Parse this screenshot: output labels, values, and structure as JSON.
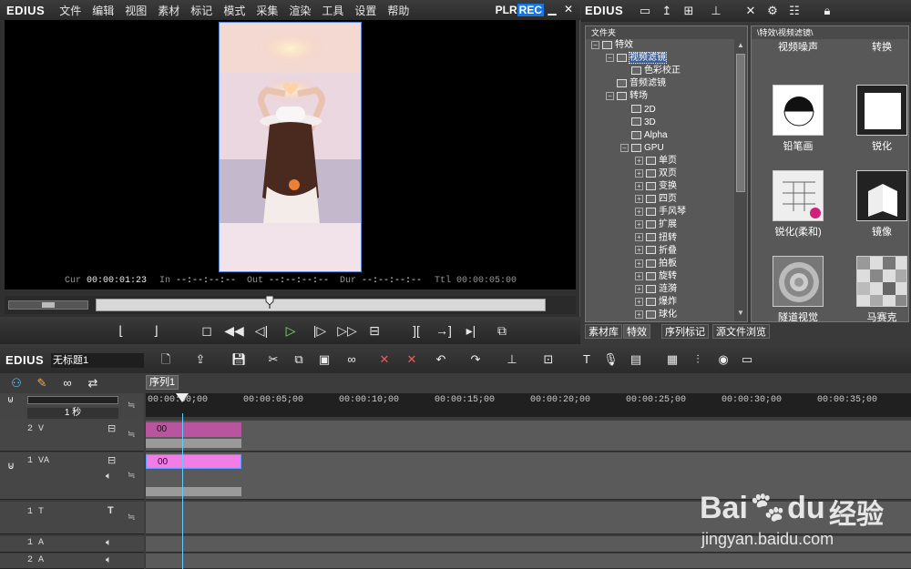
{
  "app": {
    "logo": "EDIUS",
    "plr": "PLR",
    "rec": "REC",
    "min_icon": "▁",
    "close_icon": "✕"
  },
  "menu": [
    "文件",
    "编辑",
    "视图",
    "素材",
    "标记",
    "模式",
    "采集",
    "渲染",
    "工具",
    "设置",
    "帮助"
  ],
  "player": {
    "cur_label": "Cur",
    "cur_value": "00:00:01:23",
    "in_label": "In",
    "in_value": "--:--:--:--",
    "out_label": "Out",
    "out_value": "--:--:--:--",
    "dur_label": "Dur",
    "dur_value": "--:--:--:--",
    "ttl_label": "Ttl",
    "ttl_value": "00:00:05:00"
  },
  "bin": {
    "logo": "EDIUS",
    "folder_header": "文件夹",
    "fx_header": "\\特效\\视频滤镜\\",
    "tree": [
      {
        "label": "特效",
        "indent": 0,
        "ex": "−",
        "sel": false
      },
      {
        "label": "视频滤镜",
        "indent": 1,
        "ex": "−",
        "sel": true
      },
      {
        "label": "色彩校正",
        "indent": 2,
        "ex": "",
        "sel": false
      },
      {
        "label": "音频滤镜",
        "indent": 1,
        "ex": "",
        "sel": false
      },
      {
        "label": "转场",
        "indent": 1,
        "ex": "−",
        "sel": false
      },
      {
        "label": "2D",
        "indent": 2,
        "ex": "",
        "sel": false
      },
      {
        "label": "3D",
        "indent": 2,
        "ex": "",
        "sel": false
      },
      {
        "label": "Alpha",
        "indent": 2,
        "ex": "",
        "sel": false
      },
      {
        "label": "GPU",
        "indent": 2,
        "ex": "−",
        "sel": false
      },
      {
        "label": "单页",
        "indent": 3,
        "ex": "+",
        "sel": false
      },
      {
        "label": "双页",
        "indent": 3,
        "ex": "+",
        "sel": false
      },
      {
        "label": "变换",
        "indent": 3,
        "ex": "+",
        "sel": false
      },
      {
        "label": "四页",
        "indent": 3,
        "ex": "+",
        "sel": false
      },
      {
        "label": "手风琴",
        "indent": 3,
        "ex": "+",
        "sel": false
      },
      {
        "label": "扩展",
        "indent": 3,
        "ex": "+",
        "sel": false
      },
      {
        "label": "扭转",
        "indent": 3,
        "ex": "+",
        "sel": false
      },
      {
        "label": "折叠",
        "indent": 3,
        "ex": "+",
        "sel": false
      },
      {
        "label": "拍板",
        "indent": 3,
        "ex": "+",
        "sel": false
      },
      {
        "label": "旋转",
        "indent": 3,
        "ex": "+",
        "sel": false
      },
      {
        "label": "涟漪",
        "indent": 3,
        "ex": "+",
        "sel": false
      },
      {
        "label": "爆炸",
        "indent": 3,
        "ex": "+",
        "sel": false
      },
      {
        "label": "球化",
        "indent": 3,
        "ex": "+",
        "sel": false
      }
    ],
    "effects": [
      {
        "label": "视频噪声",
        "icon": "noise-icon"
      },
      {
        "label": "转换",
        "icon": "convert-icon"
      },
      {
        "label": "铅笔画",
        "icon": "pencil-sketch-icon"
      },
      {
        "label": "锐化",
        "icon": "sharpen-icon"
      },
      {
        "label": "锐化(柔和)",
        "icon": "sharpen-soft-icon"
      },
      {
        "label": "镜像",
        "icon": "mirror-icon"
      },
      {
        "label": "隧道视觉",
        "icon": "tunnel-icon"
      },
      {
        "label": "马赛克",
        "icon": "mosaic-icon"
      }
    ],
    "tabs": [
      "素材库",
      "特效",
      "序列标记",
      "源文件浏览"
    ]
  },
  "timeline": {
    "logo": "EDIUS",
    "title": "无标题1",
    "sequence_tab": "序列1",
    "scale": "1 秒",
    "ruler": [
      "00:00:00;00",
      "00:00:05;00",
      "00:00:10;00",
      "00:00:15;00",
      "00:00:20;00",
      "00:00:25;00",
      "00:00:30;00",
      "00:00:35;00"
    ],
    "tracks": [
      {
        "name": "2 V",
        "clip": "00",
        "color": "#b9559f"
      },
      {
        "name": "1 VA",
        "clip": "00",
        "color": "#f27de6"
      },
      {
        "name": "1 T"
      },
      {
        "name": "1 A"
      },
      {
        "name": "2 A"
      }
    ]
  },
  "watermark": {
    "brand": "Bai",
    "brand2": "du",
    "cn": "经验",
    "url": "jingyan.baidu.com"
  }
}
